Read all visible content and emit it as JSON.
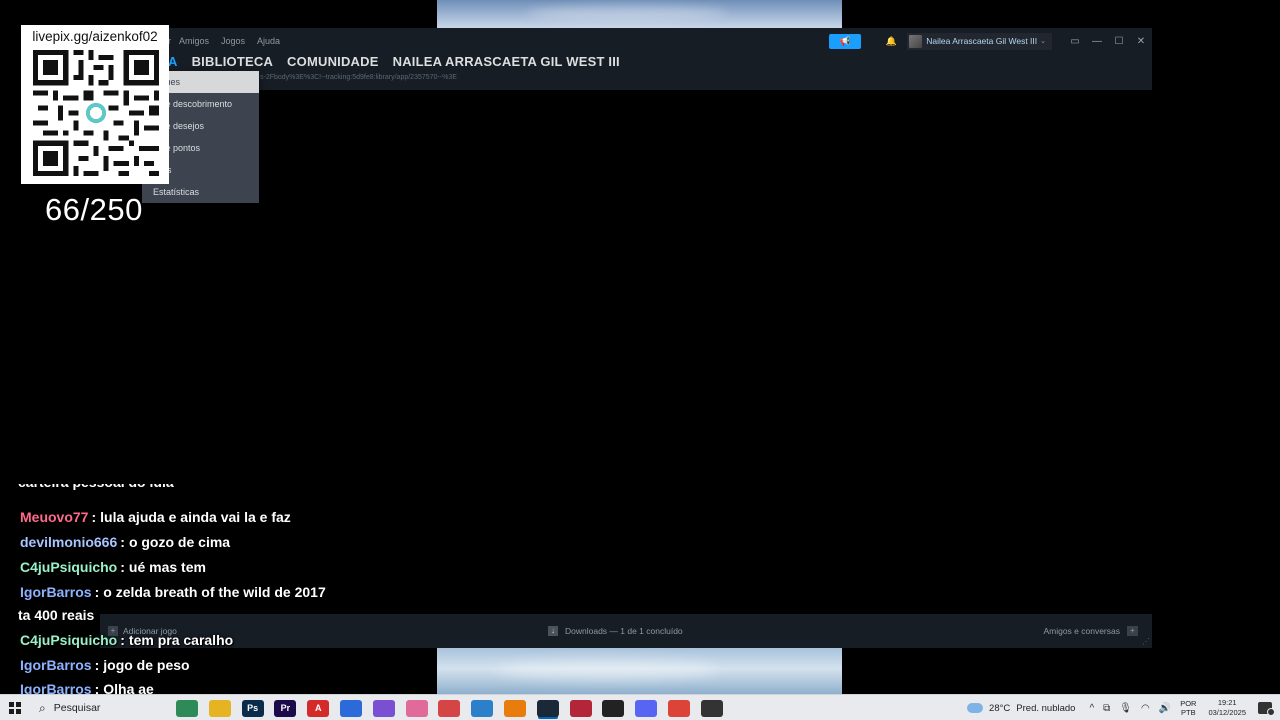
{
  "steam": {
    "top_menu": [
      "r",
      "Amigos",
      "Jogos",
      "Ajuda"
    ],
    "nav": {
      "store_partial": "A",
      "library": "BIBLIOTECA",
      "community": "COMUNIDADE",
      "profile": "NAILEA ARRASCAETA GIL WEST III"
    },
    "url": "s-2Fbody%3E%3C!--tracking:5d9fe8:library/app/2357570--%3E",
    "user_name": "Nailea Arrascaeta Gil West III",
    "dropdown": [
      "taques",
      "a de descobrimento",
      "a de desejos",
      "a de pontos",
      "ícias",
      "Estatísticas"
    ],
    "bottom": {
      "add_game": "Adicionar jogo",
      "downloads": "Downloads — 1 de 1 concluído",
      "friends": "Amigos e conversas"
    },
    "colors": {
      "accent": "#1a9fff",
      "bg": "#171d25",
      "menu": "#3d4450"
    }
  },
  "overlay": {
    "qr_url": "livepix.gg/aizenkof02",
    "counter": "66/250"
  },
  "chat": [
    {
      "user": "",
      "text": "carteira pessoal do lula",
      "color": "#ffffff"
    },
    {
      "user": "Meuovo77",
      "text": "lula ajuda e ainda vai la e faz",
      "color": "#ff6a8c"
    },
    {
      "user": "devilmonio666",
      "text": "o gozo de cima",
      "color": "#a9c4ff"
    },
    {
      "user": "C4juPsiquicho",
      "text": "ué mas tem",
      "color": "#9af0c8"
    },
    {
      "user": "IgorBarros",
      "text": "o zelda breath of the wild de 2017",
      "color": "#8fb2ff"
    },
    {
      "user": "",
      "text": "ta 400 reais",
      "color": "#ffffff"
    },
    {
      "user": "C4juPsiquicho",
      "text": "tem pra caralho",
      "color": "#9af0c8"
    },
    {
      "user": "IgorBarros",
      "text": "jogo de peso",
      "color": "#8fb2ff"
    },
    {
      "user": "IgorBarros",
      "text": "Olha ae",
      "color": "#8fb2ff"
    }
  ],
  "taskbar": {
    "search_placeholder": "Pesquisar",
    "weather_temp": "28°C",
    "weather_desc": "Pred. nublado",
    "lang_top": "POR",
    "lang_bottom": "PTB",
    "time": "19:21",
    "date": "03/12/2025",
    "apps": [
      {
        "name": "widgets-icon",
        "label": "",
        "color": "#2e8b57"
      },
      {
        "name": "file-explorer-icon",
        "label": "",
        "color": "#e6b422"
      },
      {
        "name": "photoshop-icon",
        "label": "Ps",
        "color": "#0b2b4a"
      },
      {
        "name": "premiere-icon",
        "label": "Pr",
        "color": "#1c0a4a"
      },
      {
        "name": "acrobat-icon",
        "label": "A",
        "color": "#d42a2a"
      },
      {
        "name": "notes-icon",
        "label": "",
        "color": "#2b6ad8"
      },
      {
        "name": "app-purple-icon",
        "label": "",
        "color": "#7a4fd1"
      },
      {
        "name": "app-pink-icon",
        "label": "",
        "color": "#e06b9a"
      },
      {
        "name": "calendar-icon",
        "label": "",
        "color": "#d64545"
      },
      {
        "name": "vscode-icon",
        "label": "",
        "color": "#2c7fc9"
      },
      {
        "name": "blender-icon",
        "label": "",
        "color": "#e87d0d"
      },
      {
        "name": "steam-icon",
        "label": "",
        "color": "#1b2838"
      },
      {
        "name": "app-red-icon",
        "label": "",
        "color": "#b3263a"
      },
      {
        "name": "obs-icon",
        "label": "",
        "color": "#222222"
      },
      {
        "name": "discord-icon",
        "label": "",
        "color": "#5865f2"
      },
      {
        "name": "chrome-icon",
        "label": "",
        "color": "#db4437"
      },
      {
        "name": "app-dark-icon",
        "label": "",
        "color": "#333333"
      }
    ]
  }
}
